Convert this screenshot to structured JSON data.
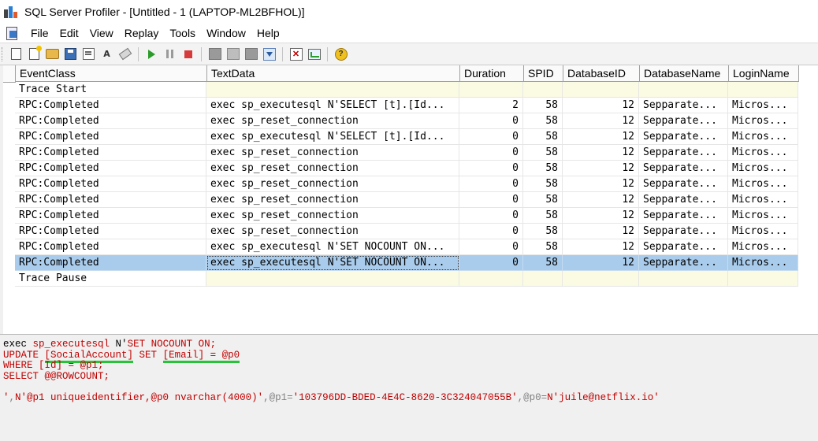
{
  "window": {
    "title": "SQL Server Profiler - [Untitled - 1 (LAPTOP-ML2BFHOL)]"
  },
  "menu": [
    "File",
    "Edit",
    "View",
    "Replay",
    "Tools",
    "Window",
    "Help"
  ],
  "toolbar_icons": [
    "new-trace-icon",
    "new-template-icon",
    "open-icon",
    "save-icon",
    "properties-icon",
    "find-icon",
    "clear-icon",
    "start-trace-icon",
    "pause-trace-icon",
    "stop-trace-icon",
    "extract-icon",
    "bind-icon",
    "filter-icon",
    "auto-scroll-icon",
    "x-icon",
    "perf-chart-icon",
    "help-icon"
  ],
  "columns": [
    "EventClass",
    "TextData",
    "Duration",
    "SPID",
    "DatabaseID",
    "DatabaseName",
    "LoginName"
  ],
  "rows": [
    {
      "event": "Trace Start",
      "text": "",
      "duration": "",
      "spid": "",
      "dbid": "",
      "dbname": "",
      "login": ""
    },
    {
      "event": "RPC:Completed",
      "text": "exec sp_executesql N'SELECT [t].[Id...",
      "duration": "2",
      "spid": "58",
      "dbid": "12",
      "dbname": "Sepparate...",
      "login": "Micros..."
    },
    {
      "event": "RPC:Completed",
      "text": "exec sp_reset_connection",
      "duration": "0",
      "spid": "58",
      "dbid": "12",
      "dbname": "Sepparate...",
      "login": "Micros..."
    },
    {
      "event": "RPC:Completed",
      "text": "exec sp_executesql N'SELECT [t].[Id...",
      "duration": "0",
      "spid": "58",
      "dbid": "12",
      "dbname": "Sepparate...",
      "login": "Micros..."
    },
    {
      "event": "RPC:Completed",
      "text": "exec sp_reset_connection",
      "duration": "0",
      "spid": "58",
      "dbid": "12",
      "dbname": "Sepparate...",
      "login": "Micros..."
    },
    {
      "event": "RPC:Completed",
      "text": "exec sp_reset_connection",
      "duration": "0",
      "spid": "58",
      "dbid": "12",
      "dbname": "Sepparate...",
      "login": "Micros..."
    },
    {
      "event": "RPC:Completed",
      "text": "exec sp_reset_connection",
      "duration": "0",
      "spid": "58",
      "dbid": "12",
      "dbname": "Sepparate...",
      "login": "Micros..."
    },
    {
      "event": "RPC:Completed",
      "text": "exec sp_reset_connection",
      "duration": "0",
      "spid": "58",
      "dbid": "12",
      "dbname": "Sepparate...",
      "login": "Micros..."
    },
    {
      "event": "RPC:Completed",
      "text": "exec sp_reset_connection",
      "duration": "0",
      "spid": "58",
      "dbid": "12",
      "dbname": "Sepparate...",
      "login": "Micros..."
    },
    {
      "event": "RPC:Completed",
      "text": "exec sp_reset_connection",
      "duration": "0",
      "spid": "58",
      "dbid": "12",
      "dbname": "Sepparate...",
      "login": "Micros..."
    },
    {
      "event": "RPC:Completed",
      "text": "exec sp_executesql N'SET NOCOUNT ON...",
      "duration": "0",
      "spid": "58",
      "dbid": "12",
      "dbname": "Sepparate...",
      "login": "Micros..."
    },
    {
      "event": "RPC:Completed",
      "text": "exec sp_executesql N'SET NOCOUNT ON...",
      "duration": "0",
      "spid": "58",
      "dbid": "12",
      "dbname": "Sepparate...",
      "login": "Micros..."
    },
    {
      "event": "Trace Pause",
      "text": "",
      "duration": "",
      "spid": "",
      "dbid": "",
      "dbname": "",
      "login": ""
    }
  ],
  "selected_row": 11,
  "sql": {
    "line1_a": "exec ",
    "line1_b": "sp_executesql",
    "line1_c": " N'",
    "line1_d": "SET NOCOUNT ON;",
    "line2_a": "UPDATE ",
    "line2_b": "[SocialAccount]",
    "line2_c": " SET ",
    "line2_d": "[Email] = @p0",
    "line3": "WHERE [Id] = @p1;",
    "line4": "SELECT @@ROWCOUNT;",
    "line6_a": "'",
    "line6_b": ",",
    "line6_c": "N'@p1 uniqueidentifier,@p0 nvarchar(4000)'",
    "line6_d": ",@p1=",
    "line6_e": "'103796DD-BDED-4E4C-8620-3C324047055B'",
    "line6_f": ",@p0=",
    "line6_g": "N'juile@netflix.io'"
  },
  "colors": {
    "selection": "#a9ccec",
    "trace_row": "#fbfbe4",
    "sql_keyword": "#c00000",
    "annotation": "#27c43a"
  }
}
